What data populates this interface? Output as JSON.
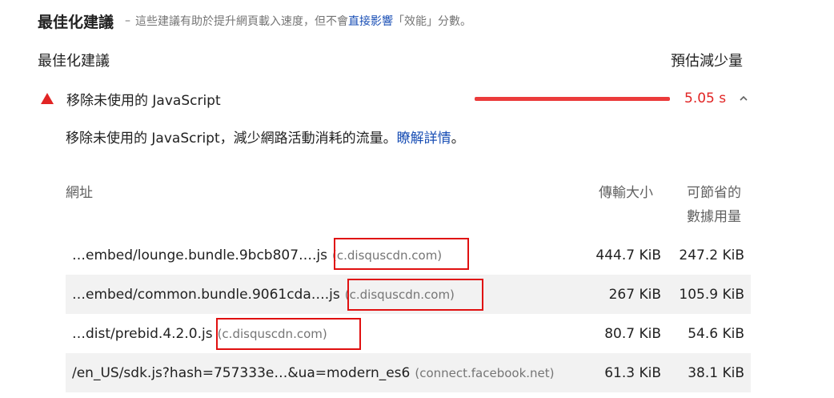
{
  "header": {
    "title": "最佳化建議",
    "dash": "–",
    "desc_before": "這些建議有助於提升網頁載入速度，但不會",
    "link": "直接影響",
    "desc_after": "「效能」分數。"
  },
  "columns": {
    "left": "最佳化建議",
    "right": "預估減少量"
  },
  "audit": {
    "title": "移除未使用的 JavaScript",
    "savings": "5.05 s",
    "status_color": "#eb3b3b",
    "icon": "warning-triangle-icon"
  },
  "description": {
    "text": "移除未使用的 JavaScript，減少網路活動消耗的流量。",
    "link": "瞭解詳情",
    "suffix": "。"
  },
  "table": {
    "header_url": "網址",
    "header_size": "傳輸大小",
    "header_wasted_line1": "可節省的",
    "header_wasted_line2": "數據用量",
    "rows": [
      {
        "url": "…embed/lounge.bundle.9bcb807….js",
        "domain": "(c.disquscdn.com)",
        "size": "444.7 KiB",
        "wasted": "247.2 KiB"
      },
      {
        "url": "…embed/common.bundle.9061cda….js",
        "domain": "(c.disquscdn.com)",
        "size": "267 KiB",
        "wasted": "105.9 KiB"
      },
      {
        "url": "…dist/prebid.4.2.0.js",
        "domain": "(c.disquscdn.com)",
        "size": "80.7 KiB",
        "wasted": "54.6 KiB"
      },
      {
        "url": "/en_US/sdk.js?hash=757333e…&ua=modern_es6",
        "domain": "(connect.facebook.net)",
        "size": "61.3 KiB",
        "wasted": "38.1 KiB"
      }
    ]
  }
}
